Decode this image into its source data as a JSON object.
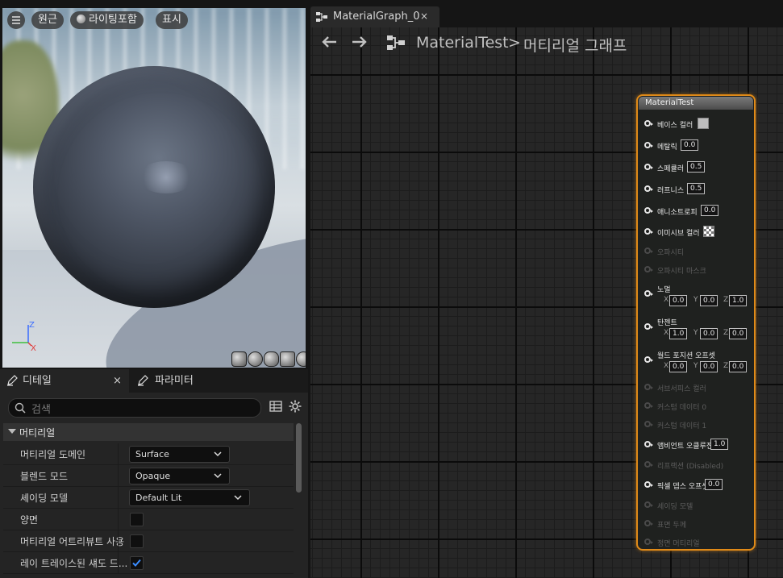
{
  "viewport": {
    "menu_icon": "hamburger-icon",
    "perspective_label": "원근",
    "lighting_label": "라이팅포함",
    "show_label": "표시",
    "axis_labels": {
      "x": "X",
      "z": "Z"
    },
    "preview_shapes": [
      "cylinder",
      "sphere",
      "plane",
      "cube",
      "teapot"
    ]
  },
  "details": {
    "tabs": [
      {
        "label": "디테일",
        "icon": "pencil-icon",
        "close": "×"
      },
      {
        "label": "파라미터",
        "icon": "pencil-icon"
      }
    ],
    "search_placeholder": "검색",
    "section_label": "머티리얼",
    "rows": [
      {
        "label": "머티리얼 도메인",
        "type": "dropdown",
        "value": "Surface"
      },
      {
        "label": "블렌드 모드",
        "type": "dropdown",
        "value": "Opaque"
      },
      {
        "label": "셰이딩 모델",
        "type": "dropdown",
        "value": "Default Lit"
      },
      {
        "label": "양면",
        "type": "checkbox",
        "checked": false
      },
      {
        "label": "머티리얼 어트리뷰트 사용",
        "type": "checkbox",
        "checked": false
      },
      {
        "label": "레이 트레이스된 섀도 드...",
        "type": "checkbox",
        "checked": true
      }
    ]
  },
  "graph": {
    "tab_label": "MaterialGraph_0",
    "tab_close": "×",
    "breadcrumb_root": "MaterialTest",
    "breadcrumb_sep": ">",
    "breadcrumb_leaf": "머티리얼 그래프",
    "node": {
      "title": "MaterialTest",
      "border_color": "#e08a18",
      "pins": [
        {
          "label": "베이스 컬러",
          "enabled": true,
          "value_type": "color",
          "color": "#bdbdbd"
        },
        {
          "label": "메탈릭",
          "enabled": true,
          "value_type": "scalar",
          "value": "0.0"
        },
        {
          "label": "스페큘러",
          "enabled": true,
          "value_type": "scalar",
          "value": "0.5"
        },
        {
          "label": "러프니스",
          "enabled": true,
          "value_type": "scalar",
          "value": "0.5"
        },
        {
          "label": "애니소트로피",
          "enabled": true,
          "value_type": "scalar",
          "value": "0.0"
        },
        {
          "label": "이미시브 컬러",
          "enabled": true,
          "value_type": "checker"
        },
        {
          "label": "오파시티",
          "enabled": false
        },
        {
          "label": "오파시티 마스크",
          "enabled": false
        },
        {
          "label": "노멀",
          "enabled": true,
          "value_type": "vector",
          "x": "0.0",
          "y": "0.0",
          "z": "1.0"
        },
        {
          "label": "탄젠트",
          "enabled": true,
          "value_type": "vector",
          "x": "1.0",
          "y": "0.0",
          "z": "0.0"
        },
        {
          "label": "월드 포지션 오프셋",
          "enabled": true,
          "value_type": "vector",
          "x": "0.0",
          "y": "0.0",
          "z": "0.0"
        },
        {
          "label": "서브서피스 컬러",
          "enabled": false
        },
        {
          "label": "커스텀 데이터 0",
          "enabled": false
        },
        {
          "label": "커스텀 데이터 1",
          "enabled": false
        },
        {
          "label": "앰비언트 오클루전",
          "enabled": true,
          "value_type": "scalar",
          "value": "1.0"
        },
        {
          "label": "리프랙션 (Disabled)",
          "enabled": false
        },
        {
          "label": "픽셀 뎁스 오프셋",
          "enabled": true,
          "value_type": "scalar",
          "value": "0.0"
        },
        {
          "label": "셰이딩 모델",
          "enabled": false
        },
        {
          "label": "표면 두께",
          "enabled": false
        },
        {
          "label": "정면 머티리얼",
          "enabled": false
        }
      ]
    }
  }
}
